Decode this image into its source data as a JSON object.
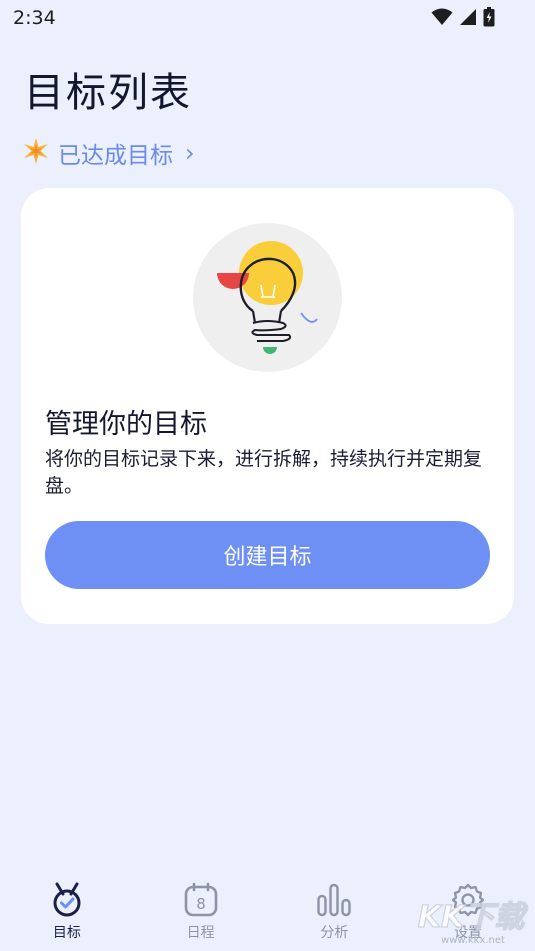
{
  "status_bar": {
    "time": "2:34",
    "icons": [
      "wifi-icon",
      "signal-icon",
      "battery-icon"
    ]
  },
  "header": {
    "title": "目标列表",
    "achieved_link": {
      "icon": "sparkle-star-icon",
      "label": "已达成目标",
      "chevron": "›"
    }
  },
  "card": {
    "illustration": "lightbulb-illustration",
    "heading": "管理你的目标",
    "description": "将你的目标记录下来，进行拆解，持续执行并定期复盘。",
    "create_button_label": "创建目标"
  },
  "bottom_nav": {
    "items": [
      {
        "label": "目标",
        "icon": "medal-check-icon",
        "active": true
      },
      {
        "label": "日程",
        "icon": "calendar-icon",
        "calendar_day": "8",
        "active": false
      },
      {
        "label": "分析",
        "icon": "bar-chart-icon",
        "active": false
      },
      {
        "label": "设置",
        "icon": "gear-icon",
        "active": false
      }
    ]
  },
  "watermark": {
    "text": "KK下载",
    "url_text": "www.kkx.net"
  },
  "colors": {
    "background": "#EBF0FC",
    "accent": "#6E8FF4",
    "link": "#6A8BEA",
    "card": "#FFFFFF",
    "nav_active": "#1A1F45",
    "nav_inactive": "#8E93A6"
  }
}
